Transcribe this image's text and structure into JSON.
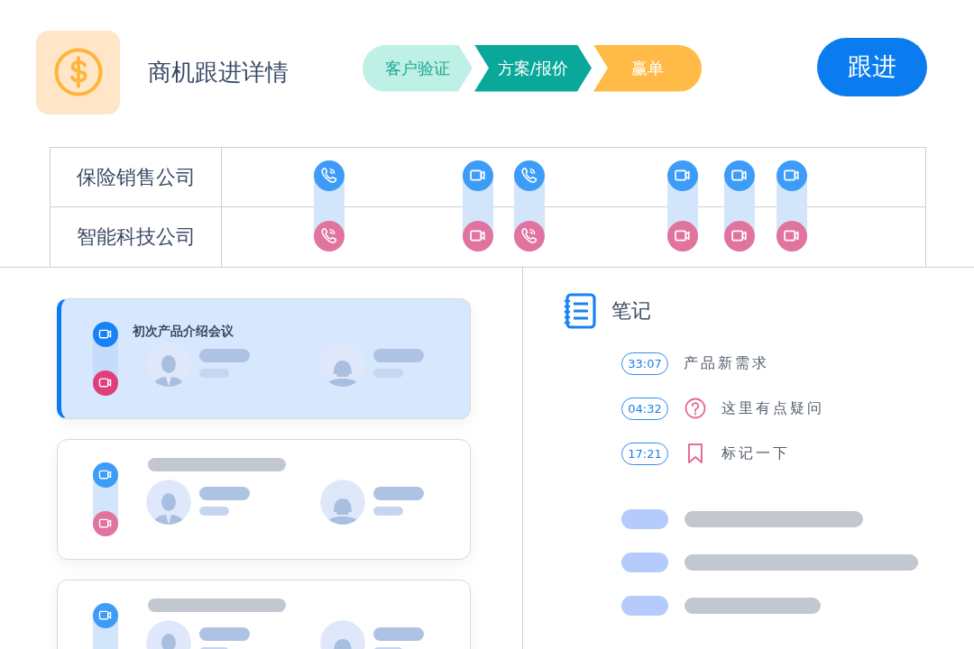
{
  "header": {
    "title": "商机跟进详情",
    "stages": [
      {
        "label": "客户验证",
        "selected": false
      },
      {
        "label": "方案/报价",
        "selected": true
      },
      {
        "label": "赢单",
        "selected": false
      }
    ],
    "follow_button": "跟进"
  },
  "timeline": {
    "rows": [
      "保险销售公司",
      "智能科技公司"
    ],
    "events": [
      {
        "kind": "call"
      },
      {
        "kind": "video"
      },
      {
        "kind": "call"
      },
      {
        "kind": "video"
      },
      {
        "kind": "video"
      },
      {
        "kind": "video"
      }
    ]
  },
  "meetings": [
    {
      "title": "初次产品介绍会议",
      "selected": true
    },
    {
      "selected": false
    },
    {
      "selected": false
    }
  ],
  "notes": {
    "title": "笔记",
    "items": [
      {
        "time": "33:07",
        "text": "产品新需求",
        "kind": "plain"
      },
      {
        "time": "04:32",
        "text": "这里有点疑问",
        "kind": "question"
      },
      {
        "time": "17:21",
        "text": "标记一下",
        "kind": "bookmark"
      }
    ]
  }
}
